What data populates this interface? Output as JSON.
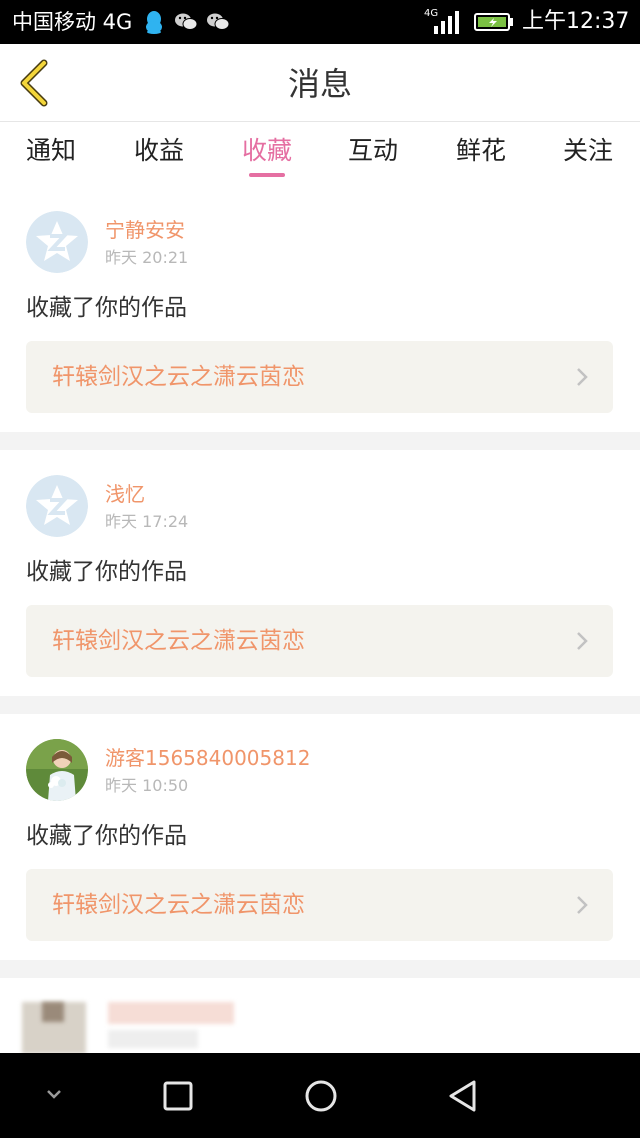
{
  "status_bar": {
    "carrier": "中国移动 4G",
    "network_badge": "4G",
    "time": "上午12:37",
    "icons": [
      "qq-icon",
      "wechat-icon",
      "wechat-icon",
      "signal-icon",
      "battery-icon"
    ]
  },
  "header": {
    "title": "消息",
    "back_icon": "chevron-left-icon"
  },
  "tabs": [
    {
      "label": "通知",
      "active": false
    },
    {
      "label": "收益",
      "active": false
    },
    {
      "label": "收藏",
      "active": true
    },
    {
      "label": "互动",
      "active": false
    },
    {
      "label": "鲜花",
      "active": false
    },
    {
      "label": "关注",
      "active": false
    }
  ],
  "messages": [
    {
      "user": "宁静安安",
      "time": "昨天 20:21",
      "action": "收藏了你的作品",
      "work": "轩辕剑汉之云之潇云茵恋",
      "avatar": "default-avatar"
    },
    {
      "user": "浅忆",
      "time": "昨天 17:24",
      "action": "收藏了你的作品",
      "work": "轩辕剑汉之云之潇云茵恋",
      "avatar": "default-avatar"
    },
    {
      "user": "游客1565840005812",
      "time": "昨天 10:50",
      "action": "收藏了你的作品",
      "work": "轩辕剑汉之云之潇云茵恋",
      "avatar": "photo-avatar"
    }
  ],
  "colors": {
    "accent": "#e56fa2",
    "username": "#f0956a",
    "work_box": "#f4f3ee",
    "separator": "#f3f3f3"
  },
  "nav_bar": {
    "icons": [
      "chevron-down-icon",
      "recent-apps-icon",
      "home-icon",
      "back-triangle-icon"
    ]
  }
}
